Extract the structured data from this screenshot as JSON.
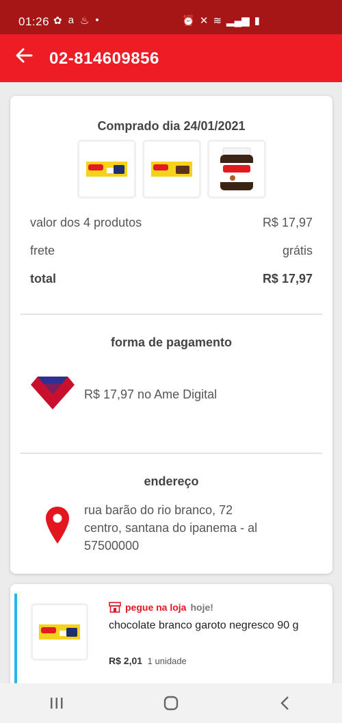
{
  "status_bar": {
    "time": "01:26"
  },
  "header": {
    "order_id": "02-814609856"
  },
  "order": {
    "purchase_label": "Comprado dia 24/01/2021",
    "products": [
      "garoto-branco-negresco",
      "garoto-chocolate-bar",
      "nutella-jar"
    ],
    "lines": [
      {
        "label": "valor dos 4 produtos",
        "value": "R$ 17,97"
      },
      {
        "label": "frete",
        "value": "grátis"
      },
      {
        "label": "total",
        "value": "R$ 17,97"
      }
    ]
  },
  "payment": {
    "title": "forma de pagamento",
    "text": "R$ 17,97 no Ame Digital",
    "logo_color": "#c8102e"
  },
  "address": {
    "title": "endereço",
    "line1": "rua barão do rio branco, 72",
    "line2": "centro, santana do ipanema - al",
    "line3": "57500000"
  },
  "item": {
    "pickup_label": "pegue na loja",
    "pickup_when": "hoje!",
    "name": "chocolate branco garoto negresco 90 g",
    "price": "R$ 2,01",
    "quantity": "1 unidade"
  },
  "colors": {
    "brand": "#ee1c25",
    "status_bar": "#a61616",
    "accent": "#2ab7e6"
  }
}
